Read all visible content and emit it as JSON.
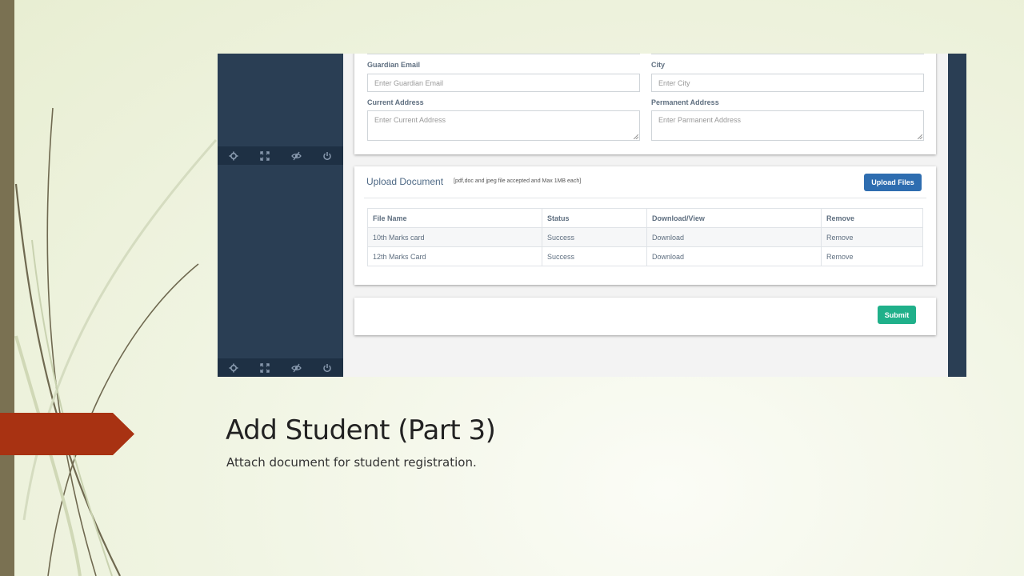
{
  "slide": {
    "title": "Add Student (Part 3)",
    "subtitle": "Attach document for student registration."
  },
  "form": {
    "guardian_email": {
      "label": "Guardian Email",
      "placeholder": "Enter Guardian Email"
    },
    "city": {
      "label": "City",
      "placeholder": "Enter City"
    },
    "current_address": {
      "label": "Current Address",
      "placeholder": "Enter Current Address"
    },
    "permanent_address": {
      "label": "Permanent Address",
      "placeholder": "Enter Parmanent Address"
    }
  },
  "upload": {
    "title": "Upload Document",
    "note": "[pdf,doc and jpeg file accepted and Max 1MB each]",
    "button_label": "Upload Files",
    "columns": [
      "File Name",
      "Status",
      "Download/View",
      "Remove"
    ],
    "rows": [
      {
        "file_name": "10th Marks card",
        "status": "Success",
        "download": "Download",
        "remove": "Remove"
      },
      {
        "file_name": "12th Marks Card",
        "status": "Success",
        "download": "Download",
        "remove": "Remove"
      }
    ]
  },
  "submit": {
    "label": "Submit"
  },
  "sidebar_tools": [
    "gear-icon",
    "fullscreen-icon",
    "eye-off-icon",
    "power-icon"
  ],
  "colors": {
    "sidebar": "#2a3e54",
    "upload_button": "#2e6db0",
    "submit_button": "#20b08a",
    "arrow": "#a83212",
    "left_bar": "#7a7152"
  }
}
